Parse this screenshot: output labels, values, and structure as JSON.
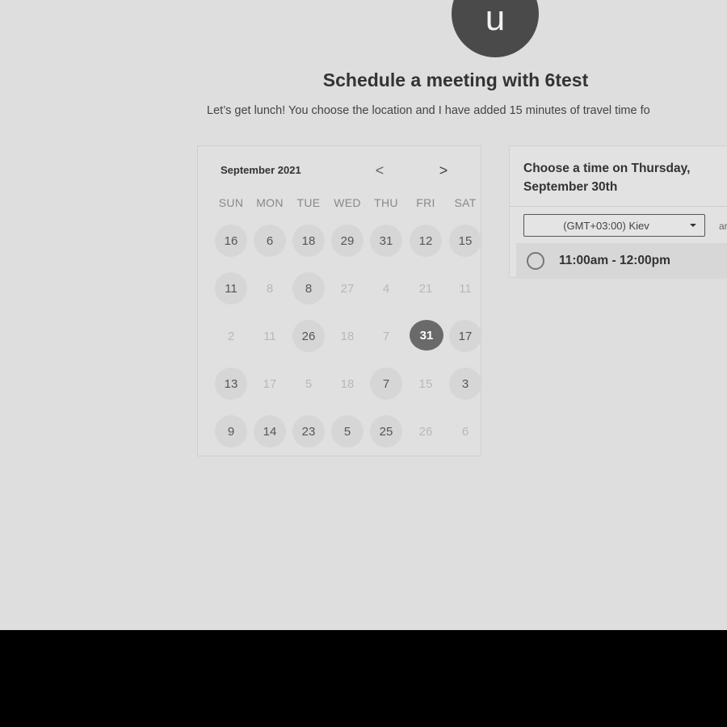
{
  "avatar": {
    "letter": "u"
  },
  "header": {
    "title": "Schedule a meeting with 6test",
    "subtitle": "Let’s get lunch! You choose the location and I have added 15 minutes of travel time fo"
  },
  "calendar": {
    "month": "September 2021",
    "prev_symbol": "<",
    "next_symbol": ">",
    "weekdays": [
      "SUN",
      "MON",
      "TUE",
      "WED",
      "THU",
      "FRI",
      "SAT"
    ],
    "weeks": [
      [
        {
          "d": "16",
          "s": "avail"
        },
        {
          "d": "6",
          "s": "avail"
        },
        {
          "d": "18",
          "s": "avail"
        },
        {
          "d": "29",
          "s": "avail"
        },
        {
          "d": "31",
          "s": "avail"
        },
        {
          "d": "12",
          "s": "avail"
        },
        {
          "d": "15",
          "s": "avail"
        }
      ],
      [
        {
          "d": "11",
          "s": "avail"
        },
        {
          "d": "8",
          "s": "dim"
        },
        {
          "d": "8",
          "s": "avail"
        },
        {
          "d": "27",
          "s": "dim"
        },
        {
          "d": "4",
          "s": "dim"
        },
        {
          "d": "21",
          "s": "dim"
        },
        {
          "d": "11",
          "s": "dim"
        }
      ],
      [
        {
          "d": "2",
          "s": "dim"
        },
        {
          "d": "11",
          "s": "dim"
        },
        {
          "d": "26",
          "s": "avail"
        },
        {
          "d": "18",
          "s": "dim"
        },
        {
          "d": "7",
          "s": "dim"
        },
        {
          "d": "31",
          "s": "selected"
        },
        {
          "d": "17",
          "s": "avail"
        }
      ],
      [
        {
          "d": "13",
          "s": "avail"
        },
        {
          "d": "17",
          "s": "dim"
        },
        {
          "d": "5",
          "s": "dim"
        },
        {
          "d": "18",
          "s": "dim"
        },
        {
          "d": "7",
          "s": "avail"
        },
        {
          "d": "15",
          "s": "dim"
        },
        {
          "d": "3",
          "s": "avail"
        }
      ],
      [
        {
          "d": "9",
          "s": "avail"
        },
        {
          "d": "14",
          "s": "avail"
        },
        {
          "d": "23",
          "s": "avail"
        },
        {
          "d": "5",
          "s": "avail"
        },
        {
          "d": "25",
          "s": "avail"
        },
        {
          "d": "26",
          "s": "dim"
        },
        {
          "d": "6",
          "s": "dim"
        }
      ]
    ]
  },
  "panel": {
    "heading": "Choose a time on Thursday, September 30th",
    "timezone": "(GMT+03:00) Kiev",
    "timezone_extra": "ar",
    "slots": [
      "11:00am - 12:00pm"
    ]
  },
  "colors": {
    "page_bg": "#dedede",
    "avatar_bg": "#4a4a4a",
    "selected_day": "#6a6a6a",
    "footer_band": "#000000"
  }
}
